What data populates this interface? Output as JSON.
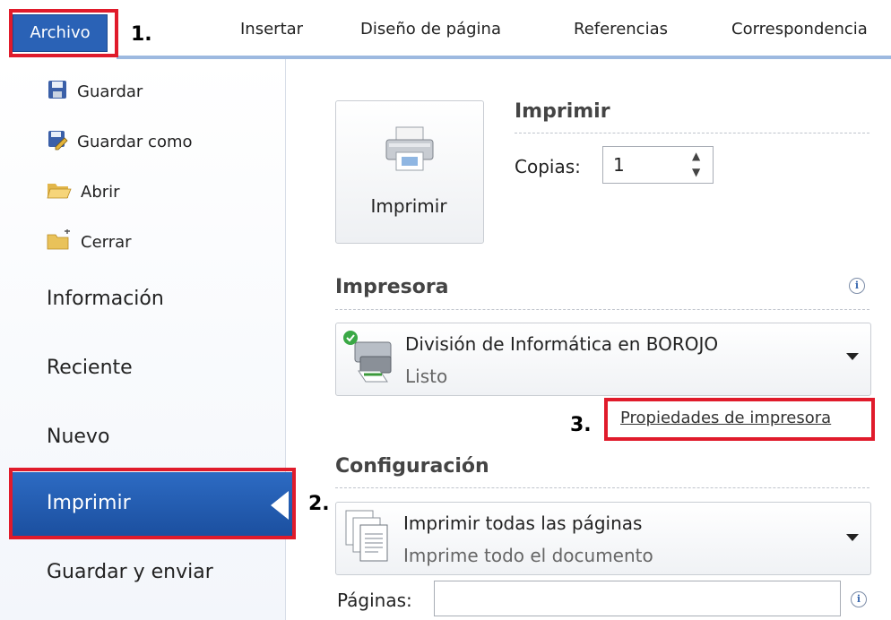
{
  "ribbon": {
    "file_tab": "Archivo",
    "tabs": [
      "Insertar",
      "Diseño de página",
      "Referencias",
      "Correspondencia"
    ]
  },
  "steps": {
    "one": "1.",
    "two": "2.",
    "three": "3."
  },
  "nav": {
    "save": "Guardar",
    "save_as": "Guardar como",
    "open": "Abrir",
    "close": "Cerrar",
    "info": "Información",
    "recent": "Reciente",
    "new": "Nuevo",
    "print": "Imprimir",
    "save_send": "Guardar y enviar"
  },
  "print": {
    "button_label": "Imprimir",
    "section_title": "Imprimir",
    "copies_label": "Copias:",
    "copies_value": "1"
  },
  "printer": {
    "section_title": "Impresora",
    "name": "División de Informática en BOROJO",
    "status": "Listo",
    "properties_link": "Propiedades de impresora"
  },
  "settings": {
    "section_title": "Configuración",
    "range_main": "Imprimir todas las páginas",
    "range_sub": "Imprime todo el documento",
    "pages_label": "Páginas:",
    "pages_value": ""
  },
  "colors": {
    "accent": "#2a62b6",
    "highlight": "#e01b2b"
  },
  "icons": [
    "save-icon",
    "save-as-icon",
    "open-folder-icon",
    "close-folder-icon",
    "printer-icon",
    "printer-ready-icon",
    "pages-icon",
    "info-icon"
  ]
}
